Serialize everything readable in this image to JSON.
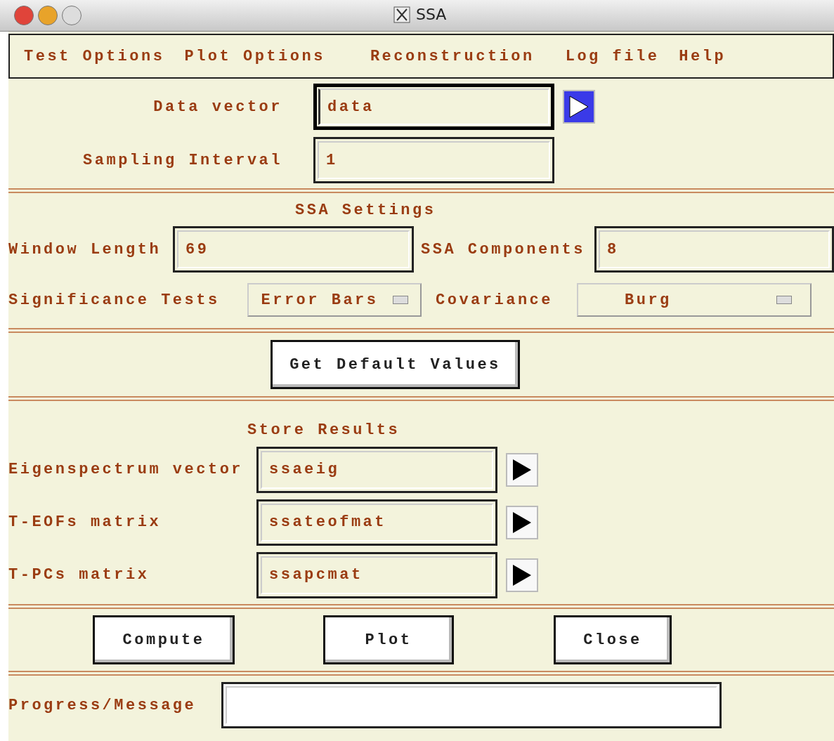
{
  "window": {
    "title": "SSA"
  },
  "menu": [
    "Test Options",
    "Plot Options",
    "Reconstruction",
    "Log file",
    "Help"
  ],
  "input_fields": [
    {
      "label": "Data vector",
      "value": "data",
      "kind": "arrow",
      "focused": true
    },
    {
      "label": "Sampling Interval",
      "value": "1",
      "kind": "plain",
      "focused": false
    }
  ],
  "ssa_settings": {
    "title": "SSA Settings",
    "window_length": {
      "label": "Window Length",
      "value": "69"
    },
    "components": {
      "label": "SSA Components",
      "value": "8"
    },
    "significance_tests": {
      "label": "Significance Tests",
      "value": "Error Bars"
    },
    "covariance": {
      "label": "Covariance",
      "value": "Burg"
    }
  },
  "default_button": "Get Default Values",
  "store_results": {
    "title": "Store Results",
    "rows": [
      {
        "label": "Eigenspectrum vector",
        "value": "ssaeig"
      },
      {
        "label": "T-EOFs matrix",
        "value": "ssateofmat"
      },
      {
        "label": "T-PCs matrix",
        "value": "ssapcmat"
      }
    ]
  },
  "buttons": [
    "Compute",
    "Plot",
    "Close"
  ],
  "progress": {
    "label": "Progress/Message"
  }
}
